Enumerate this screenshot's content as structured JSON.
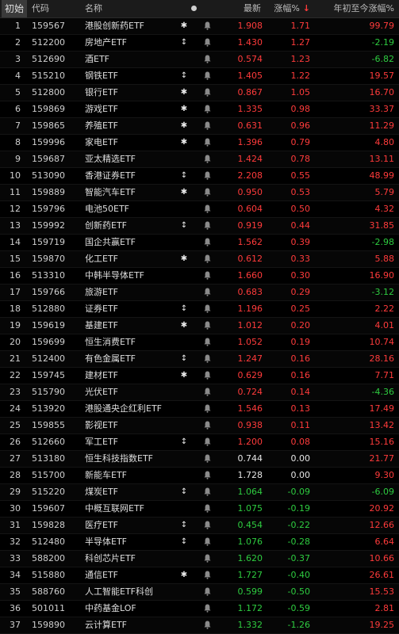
{
  "header": {
    "index_label": "初始",
    "code_label": "代码",
    "name_label": "名称",
    "dot_icon": "circle-dot",
    "price_label": "最新",
    "change_label": "涨幅%",
    "sort_arrow": "↓",
    "ytd_label": "年初至今涨幅%"
  },
  "colors": {
    "up": "#ff3b3b",
    "down": "#2ecc40",
    "flat": "#e6e6e6"
  },
  "rows": [
    {
      "idx": "1",
      "code": "159567",
      "name": "港股创新药ETF",
      "mark": "✱",
      "price": "1.908",
      "change": "1.71",
      "ytd": "99.79",
      "dir": "up",
      "ytd_dir": "up"
    },
    {
      "idx": "2",
      "code": "512200",
      "name": "房地产ETF",
      "mark": "↕",
      "price": "1.430",
      "change": "1.27",
      "ytd": "-2.19",
      "dir": "up",
      "ytd_dir": "down"
    },
    {
      "idx": "3",
      "code": "512690",
      "name": "酒ETF",
      "mark": "",
      "price": "0.574",
      "change": "1.23",
      "ytd": "-6.82",
      "dir": "up",
      "ytd_dir": "down"
    },
    {
      "idx": "4",
      "code": "515210",
      "name": "钢铁ETF",
      "mark": "↕",
      "price": "1.405",
      "change": "1.22",
      "ytd": "19.57",
      "dir": "up",
      "ytd_dir": "up"
    },
    {
      "idx": "5",
      "code": "512800",
      "name": "银行ETF",
      "mark": "✱",
      "price": "0.867",
      "change": "1.05",
      "ytd": "16.70",
      "dir": "up",
      "ytd_dir": "up"
    },
    {
      "idx": "6",
      "code": "159869",
      "name": "游戏ETF",
      "mark": "✱",
      "price": "1.335",
      "change": "0.98",
      "ytd": "33.37",
      "dir": "up",
      "ytd_dir": "up"
    },
    {
      "idx": "7",
      "code": "159865",
      "name": "养殖ETF",
      "mark": "✱",
      "price": "0.631",
      "change": "0.96",
      "ytd": "11.29",
      "dir": "up",
      "ytd_dir": "up"
    },
    {
      "idx": "8",
      "code": "159996",
      "name": "家电ETF",
      "mark": "✱",
      "price": "1.396",
      "change": "0.79",
      "ytd": "4.80",
      "dir": "up",
      "ytd_dir": "up"
    },
    {
      "idx": "9",
      "code": "159687",
      "name": "亚太精选ETF",
      "mark": "",
      "price": "1.424",
      "change": "0.78",
      "ytd": "13.11",
      "dir": "up",
      "ytd_dir": "up"
    },
    {
      "idx": "10",
      "code": "513090",
      "name": "香港证券ETF",
      "mark": "↕",
      "price": "2.208",
      "change": "0.55",
      "ytd": "48.99",
      "dir": "up",
      "ytd_dir": "up"
    },
    {
      "idx": "11",
      "code": "159889",
      "name": "智能汽车ETF",
      "mark": "✱",
      "price": "0.950",
      "change": "0.53",
      "ytd": "5.79",
      "dir": "up",
      "ytd_dir": "up"
    },
    {
      "idx": "12",
      "code": "159796",
      "name": "电池50ETF",
      "mark": "",
      "price": "0.604",
      "change": "0.50",
      "ytd": "4.32",
      "dir": "up",
      "ytd_dir": "up"
    },
    {
      "idx": "13",
      "code": "159992",
      "name": "创新药ETF",
      "mark": "↕",
      "price": "0.919",
      "change": "0.44",
      "ytd": "31.85",
      "dir": "up",
      "ytd_dir": "up"
    },
    {
      "idx": "14",
      "code": "159719",
      "name": "国企共赢ETF",
      "mark": "",
      "price": "1.562",
      "change": "0.39",
      "ytd": "-2.98",
      "dir": "up",
      "ytd_dir": "down"
    },
    {
      "idx": "15",
      "code": "159870",
      "name": "化工ETF",
      "mark": "✱",
      "price": "0.612",
      "change": "0.33",
      "ytd": "5.88",
      "dir": "up",
      "ytd_dir": "up"
    },
    {
      "idx": "16",
      "code": "513310",
      "name": "中韩半导体ETF",
      "mark": "",
      "price": "1.660",
      "change": "0.30",
      "ytd": "16.90",
      "dir": "up",
      "ytd_dir": "up"
    },
    {
      "idx": "17",
      "code": "159766",
      "name": "旅游ETF",
      "mark": "",
      "price": "0.683",
      "change": "0.29",
      "ytd": "-3.12",
      "dir": "up",
      "ytd_dir": "down"
    },
    {
      "idx": "18",
      "code": "512880",
      "name": "证券ETF",
      "mark": "↕",
      "price": "1.196",
      "change": "0.25",
      "ytd": "2.22",
      "dir": "up",
      "ytd_dir": "up"
    },
    {
      "idx": "19",
      "code": "159619",
      "name": "基建ETF",
      "mark": "✱",
      "price": "1.012",
      "change": "0.20",
      "ytd": "4.01",
      "dir": "up",
      "ytd_dir": "up"
    },
    {
      "idx": "20",
      "code": "159699",
      "name": "恒生消费ETF",
      "mark": "",
      "price": "1.052",
      "change": "0.19",
      "ytd": "10.74",
      "dir": "up",
      "ytd_dir": "up"
    },
    {
      "idx": "21",
      "code": "512400",
      "name": "有色金属ETF",
      "mark": "↕",
      "price": "1.247",
      "change": "0.16",
      "ytd": "28.16",
      "dir": "up",
      "ytd_dir": "up"
    },
    {
      "idx": "22",
      "code": "159745",
      "name": "建材ETF",
      "mark": "✱",
      "price": "0.629",
      "change": "0.16",
      "ytd": "7.71",
      "dir": "up",
      "ytd_dir": "up"
    },
    {
      "idx": "23",
      "code": "515790",
      "name": "光伏ETF",
      "mark": "",
      "price": "0.724",
      "change": "0.14",
      "ytd": "-4.36",
      "dir": "up",
      "ytd_dir": "down"
    },
    {
      "idx": "24",
      "code": "513920",
      "name": "港股通央企红利ETF",
      "mark": "",
      "price": "1.546",
      "change": "0.13",
      "ytd": "17.49",
      "dir": "up",
      "ytd_dir": "up"
    },
    {
      "idx": "25",
      "code": "159855",
      "name": "影视ETF",
      "mark": "",
      "price": "0.938",
      "change": "0.11",
      "ytd": "13.42",
      "dir": "up",
      "ytd_dir": "up"
    },
    {
      "idx": "26",
      "code": "512660",
      "name": "军工ETF",
      "mark": "↕",
      "price": "1.200",
      "change": "0.08",
      "ytd": "15.16",
      "dir": "up",
      "ytd_dir": "up"
    },
    {
      "idx": "27",
      "code": "513180",
      "name": "恒生科技指数ETF",
      "mark": "",
      "price": "0.744",
      "change": "0.00",
      "ytd": "21.77",
      "dir": "flat",
      "ytd_dir": "up"
    },
    {
      "idx": "28",
      "code": "515700",
      "name": "新能车ETF",
      "mark": "",
      "price": "1.728",
      "change": "0.00",
      "ytd": "9.30",
      "dir": "flat",
      "ytd_dir": "up"
    },
    {
      "idx": "29",
      "code": "515220",
      "name": "煤炭ETF",
      "mark": "↕",
      "price": "1.064",
      "change": "-0.09",
      "ytd": "-6.09",
      "dir": "down",
      "ytd_dir": "down"
    },
    {
      "idx": "30",
      "code": "159607",
      "name": "中概互联网ETF",
      "mark": "",
      "price": "1.075",
      "change": "-0.19",
      "ytd": "20.92",
      "dir": "down",
      "ytd_dir": "up"
    },
    {
      "idx": "31",
      "code": "159828",
      "name": "医疗ETF",
      "mark": "↕",
      "price": "0.454",
      "change": "-0.22",
      "ytd": "12.66",
      "dir": "down",
      "ytd_dir": "up"
    },
    {
      "idx": "32",
      "code": "512480",
      "name": "半导体ETF",
      "mark": "↕",
      "price": "1.076",
      "change": "-0.28",
      "ytd": "6.64",
      "dir": "down",
      "ytd_dir": "up"
    },
    {
      "idx": "33",
      "code": "588200",
      "name": "科创芯片ETF",
      "mark": "",
      "price": "1.620",
      "change": "-0.37",
      "ytd": "10.66",
      "dir": "down",
      "ytd_dir": "up"
    },
    {
      "idx": "34",
      "code": "515880",
      "name": "通信ETF",
      "mark": "✱",
      "price": "1.727",
      "change": "-0.40",
      "ytd": "26.61",
      "dir": "down",
      "ytd_dir": "up"
    },
    {
      "idx": "35",
      "code": "588760",
      "name": "人工智能ETF科创",
      "mark": "",
      "price": "0.599",
      "change": "-0.50",
      "ytd": "15.53",
      "dir": "down",
      "ytd_dir": "up"
    },
    {
      "idx": "36",
      "code": "501011",
      "name": "中药基金LOF",
      "mark": "",
      "price": "1.172",
      "change": "-0.59",
      "ytd": "2.81",
      "dir": "down",
      "ytd_dir": "up"
    },
    {
      "idx": "37",
      "code": "159890",
      "name": "云计算ETF",
      "mark": "",
      "price": "1.332",
      "change": "-1.26",
      "ytd": "19.25",
      "dir": "down",
      "ytd_dir": "up"
    }
  ]
}
